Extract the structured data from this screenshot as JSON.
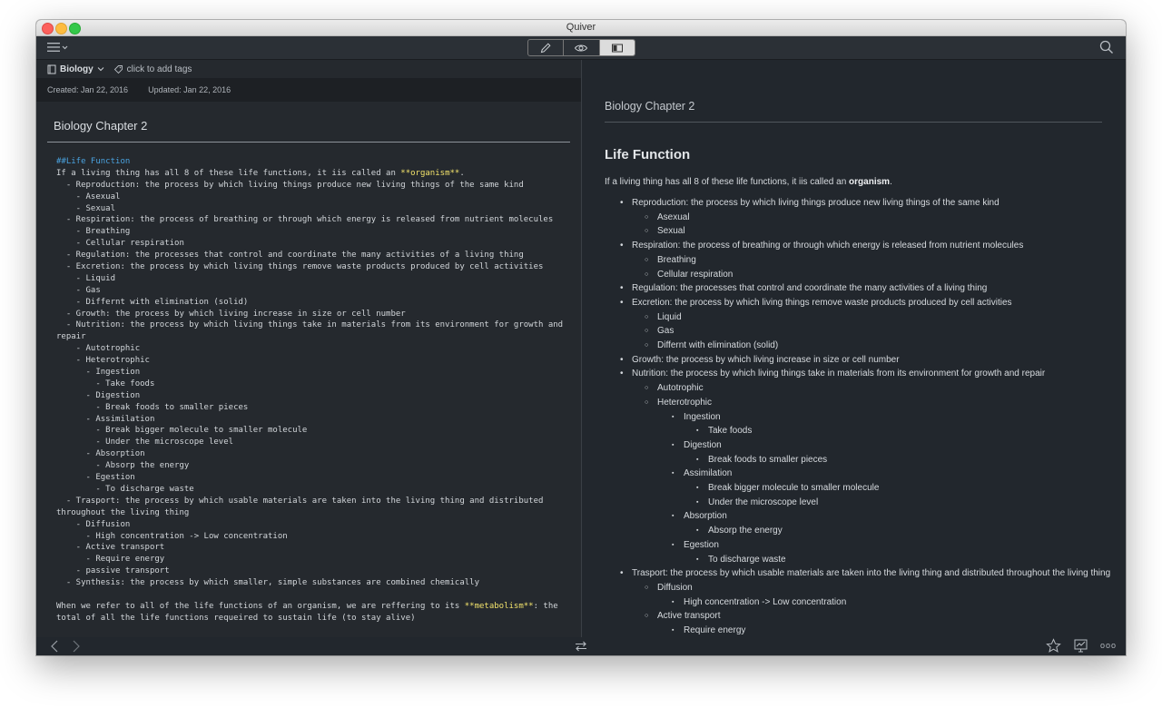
{
  "window": {
    "title": "Quiver"
  },
  "toolbar": {
    "menu_icon": "hamburger-icon",
    "modes": [
      {
        "name": "edit",
        "icon": "pencil-icon"
      },
      {
        "name": "preview",
        "icon": "eye-icon"
      },
      {
        "name": "split",
        "icon": "split-view-icon",
        "active": true
      }
    ],
    "search_icon": "search-icon"
  },
  "note": {
    "notebook": "Biology",
    "tags_placeholder": "click to add tags",
    "created": "Created: Jan 22, 2016",
    "updated": "Updated: Jan 22, 2016",
    "title": "Biology Chapter 2"
  },
  "editor": {
    "lines": [
      "##Life Function",
      "If a living thing has all 8 of these life functions, it iis called an **organism**.",
      "  - Reproduction: the process by which living things produce new living things of the same kind",
      "    - Asexual",
      "    - Sexual",
      "  - Respiration: the process of breathing or through which energy is released from nutrient molecules",
      "    - Breathing",
      "    - Cellular respiration",
      "  - Regulation: the processes that control and coordinate the many activities of a living thing",
      "  - Excretion: the process by which living things remove waste products produced by cell activities",
      "    - Liquid",
      "    - Gas",
      "    - Differnt with elimination (solid)",
      "  - Growth: the process by which living increase in size or cell number",
      "  - Nutrition: the process by which living things take in materials from its environment for growth and",
      "repair",
      "    - Autotrophic",
      "    - Heterotrophic",
      "      - Ingestion",
      "        - Take foods",
      "      - Digestion",
      "        - Break foods to smaller pieces",
      "      - Assimilation",
      "        - Break bigger molecule to smaller molecule",
      "        - Under the microscope level",
      "      - Absorption",
      "        - Absorp the energy",
      "      - Egestion",
      "        - To discharge waste",
      "  - Trasport: the process by which usable materials are taken into the living thing and distributed",
      "throughout the living thing",
      "    - Diffusion",
      "      - High concentration -> Low concentration",
      "    - Active transport",
      "      - Require energy",
      "    - passive transport",
      "  - Synthesis: the process by which smaller, simple substances are combined chemically",
      "",
      "When we refer to all of the life functions of an organism, we are reffering to its **metabolism**: the",
      "total of all the life functions requeired to sustain life (to stay alive)"
    ]
  },
  "preview": {
    "title": "Biology Chapter 2",
    "heading": "Life Function",
    "intro_before": "If a living thing has all 8 of these life functions, it iis called an ",
    "intro_bold": "organism",
    "intro_after": ".",
    "items": [
      {
        "level": 1,
        "text": "Reproduction: the process by which living things produce new living things of the same kind"
      },
      {
        "level": 2,
        "text": "Asexual"
      },
      {
        "level": 2,
        "text": "Sexual"
      },
      {
        "level": 1,
        "text": "Respiration: the process of breathing or through which energy is released from nutrient molecules"
      },
      {
        "level": 2,
        "text": "Breathing"
      },
      {
        "level": 2,
        "text": "Cellular respiration"
      },
      {
        "level": 1,
        "text": "Regulation: the processes that control and coordinate the many activities of a living thing"
      },
      {
        "level": 1,
        "text": "Excretion: the process by which living things remove waste products produced by cell activities"
      },
      {
        "level": 2,
        "text": "Liquid"
      },
      {
        "level": 2,
        "text": "Gas"
      },
      {
        "level": 2,
        "text": "Differnt with elimination (solid)"
      },
      {
        "level": 1,
        "text": "Growth: the process by which living increase in size or cell number"
      },
      {
        "level": 1,
        "text": "Nutrition: the process by which living things take in materials from its environment for growth and repair"
      },
      {
        "level": 2,
        "text": "Autotrophic"
      },
      {
        "level": 2,
        "text": "Heterotrophic"
      },
      {
        "level": 3,
        "text": "Ingestion"
      },
      {
        "level": 4,
        "text": "Take foods"
      },
      {
        "level": 3,
        "text": "Digestion"
      },
      {
        "level": 4,
        "text": "Break foods to smaller pieces"
      },
      {
        "level": 3,
        "text": "Assimilation"
      },
      {
        "level": 4,
        "text": "Break bigger molecule to smaller molecule"
      },
      {
        "level": 4,
        "text": "Under the microscope level"
      },
      {
        "level": 3,
        "text": "Absorption"
      },
      {
        "level": 4,
        "text": "Absorp the energy"
      },
      {
        "level": 3,
        "text": "Egestion"
      },
      {
        "level": 4,
        "text": "To discharge waste"
      },
      {
        "level": 1,
        "text": "Trasport: the process by which usable materials are taken into the living thing and distributed throughout the living thing"
      },
      {
        "level": 2,
        "text": "Diffusion"
      },
      {
        "level": 3,
        "text": "High concentration -> Low concentration"
      },
      {
        "level": 2,
        "text": "Active transport"
      },
      {
        "level": 3,
        "text": "Require energy"
      }
    ]
  },
  "statusbar": {
    "back_icon": "chevron-left-icon",
    "forward_icon": "chevron-right-icon",
    "swap_icon": "swap-arrows-icon",
    "star_icon": "star-icon",
    "presentation_icon": "presentation-icon",
    "more_label": "ooo"
  }
}
